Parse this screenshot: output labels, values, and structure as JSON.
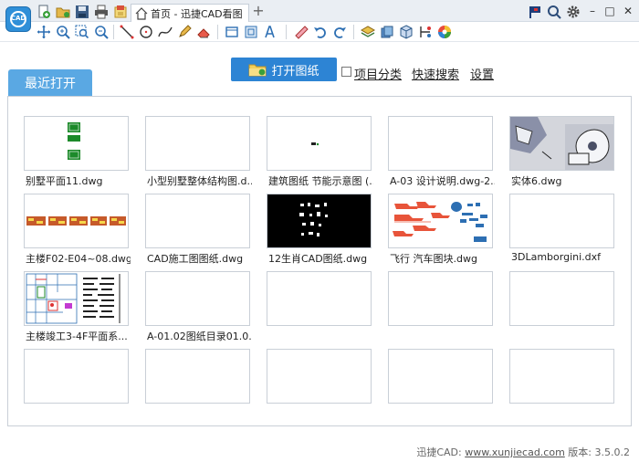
{
  "app": {
    "logo_text": "CAD",
    "tab_title": "首页 - 迅捷CAD看图"
  },
  "actions": {
    "open_label": "打开图纸",
    "category_label": "项目分类",
    "search_label": "快速搜索",
    "settings_label": "设置"
  },
  "panel": {
    "tab_label": "最近打开"
  },
  "files": [
    {
      "name": "别墅平面11.dwg",
      "thumb": "villa"
    },
    {
      "name": "小型别墅整体结构图.d...",
      "thumb": "blank"
    },
    {
      "name": "建筑图纸 节能示意图 (...",
      "thumb": "dot"
    },
    {
      "name": "A-03 设计说明.dwg-2...",
      "thumb": "blank"
    },
    {
      "name": "实体6.dwg",
      "thumb": "mech"
    },
    {
      "name": "主楼F02-E04~08.dwg",
      "thumb": "rows"
    },
    {
      "name": "CAD施工图图纸.dwg",
      "thumb": "blank"
    },
    {
      "name": "12生肖CAD图纸.dwg",
      "thumb": "zodiac"
    },
    {
      "name": "飞行 汽车图块.dwg",
      "thumb": "cars"
    },
    {
      "name": "3DLamborgini.dxf",
      "thumb": "blank"
    },
    {
      "name": "主楼竣工3-4F平面系...",
      "thumb": "plan"
    },
    {
      "name": "A-01.02图纸目录01.0...",
      "thumb": "blank"
    },
    {
      "name": "",
      "thumb": "blank"
    },
    {
      "name": "",
      "thumb": "blank"
    },
    {
      "name": "",
      "thumb": "blank"
    },
    {
      "name": "",
      "thumb": "blank"
    },
    {
      "name": "",
      "thumb": "blank"
    },
    {
      "name": "",
      "thumb": "blank"
    },
    {
      "name": "",
      "thumb": "blank"
    },
    {
      "name": "",
      "thumb": "blank"
    }
  ],
  "footer": {
    "prefix": "迅捷CAD:",
    "url": "www.xunjiecad.com",
    "version_label": "版本:",
    "version": "3.5.0.2"
  },
  "toolbar_icons": [
    "new-file-icon",
    "open-folder-icon",
    "save-icon",
    "print-icon",
    "batch-convert-icon",
    "pan-icon",
    "zoom-in-icon",
    "zoom-window-icon",
    "zoom-out-icon",
    "line-icon",
    "circle-icon",
    "curve-icon",
    "pencil-icon",
    "eraser-icon",
    "rectangle-icon",
    "layer-icon",
    "text-icon",
    "ruler-icon",
    "undo-icon",
    "redo-icon",
    "layers-icon",
    "block-icon",
    "cube-icon",
    "measure-icon",
    "color-wheel-icon",
    "flag-icon",
    "search-icon",
    "gear-icon",
    "minimize-icon",
    "maximize-icon",
    "close-icon"
  ],
  "colors": {
    "accent": "#2d84d4",
    "tab_blue": "#5aa8e3"
  }
}
